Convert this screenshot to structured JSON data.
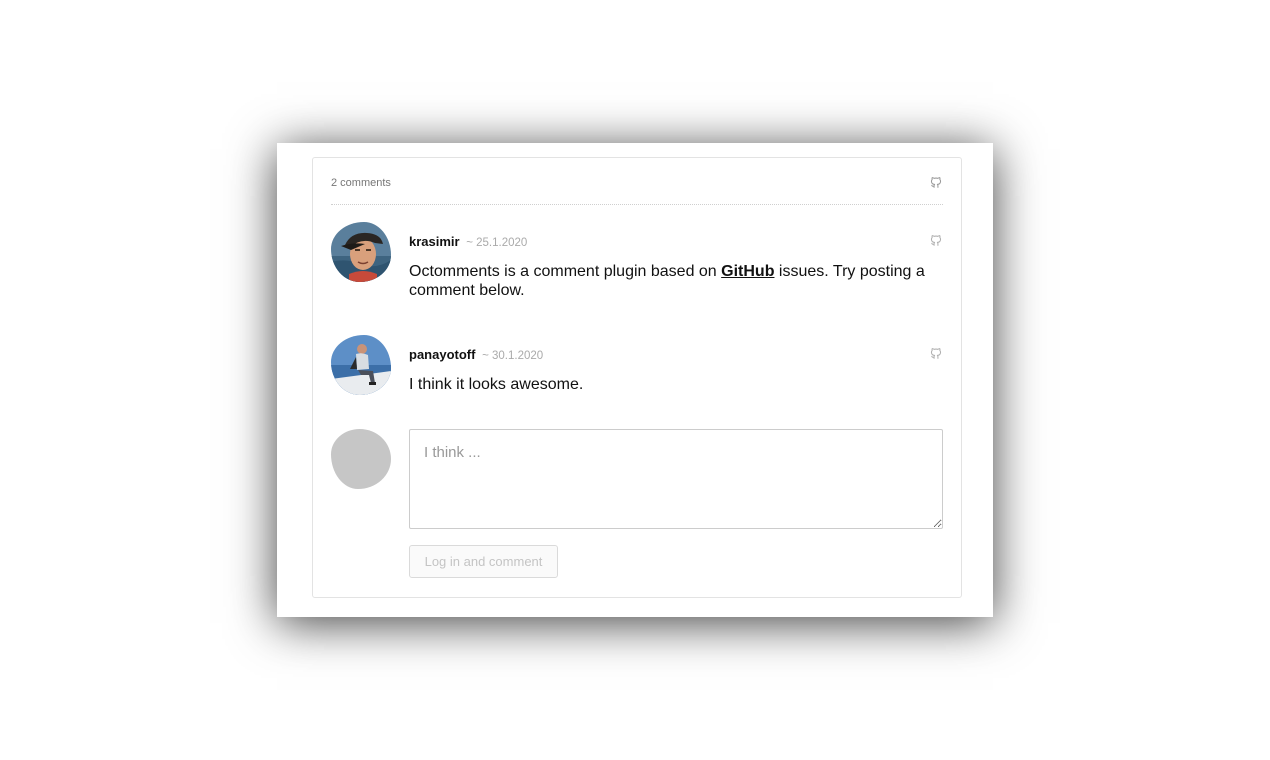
{
  "header": {
    "comment_count": "2 comments",
    "github_icon": "github-icon"
  },
  "comments": [
    {
      "author": "krasimir",
      "date": "~ 25.1.2020",
      "body_before": "Octomments is a comment plugin based on ",
      "body_link": "GitHub",
      "body_after": " issues. Try posting a comment below.",
      "avatar": "user-photo-krasimir"
    },
    {
      "author": "panayotoff",
      "date": "~ 30.1.2020",
      "body": "I think it looks awesome.",
      "avatar": "user-photo-panayotoff"
    }
  ],
  "new_comment": {
    "placeholder": "I think ...",
    "value": "",
    "submit_label": "Log in and comment"
  },
  "colors": {
    "muted_icon": "#b0b0b0",
    "avatar_placeholder": "#c6c6c6",
    "date_gray": "#aaaaaa"
  }
}
